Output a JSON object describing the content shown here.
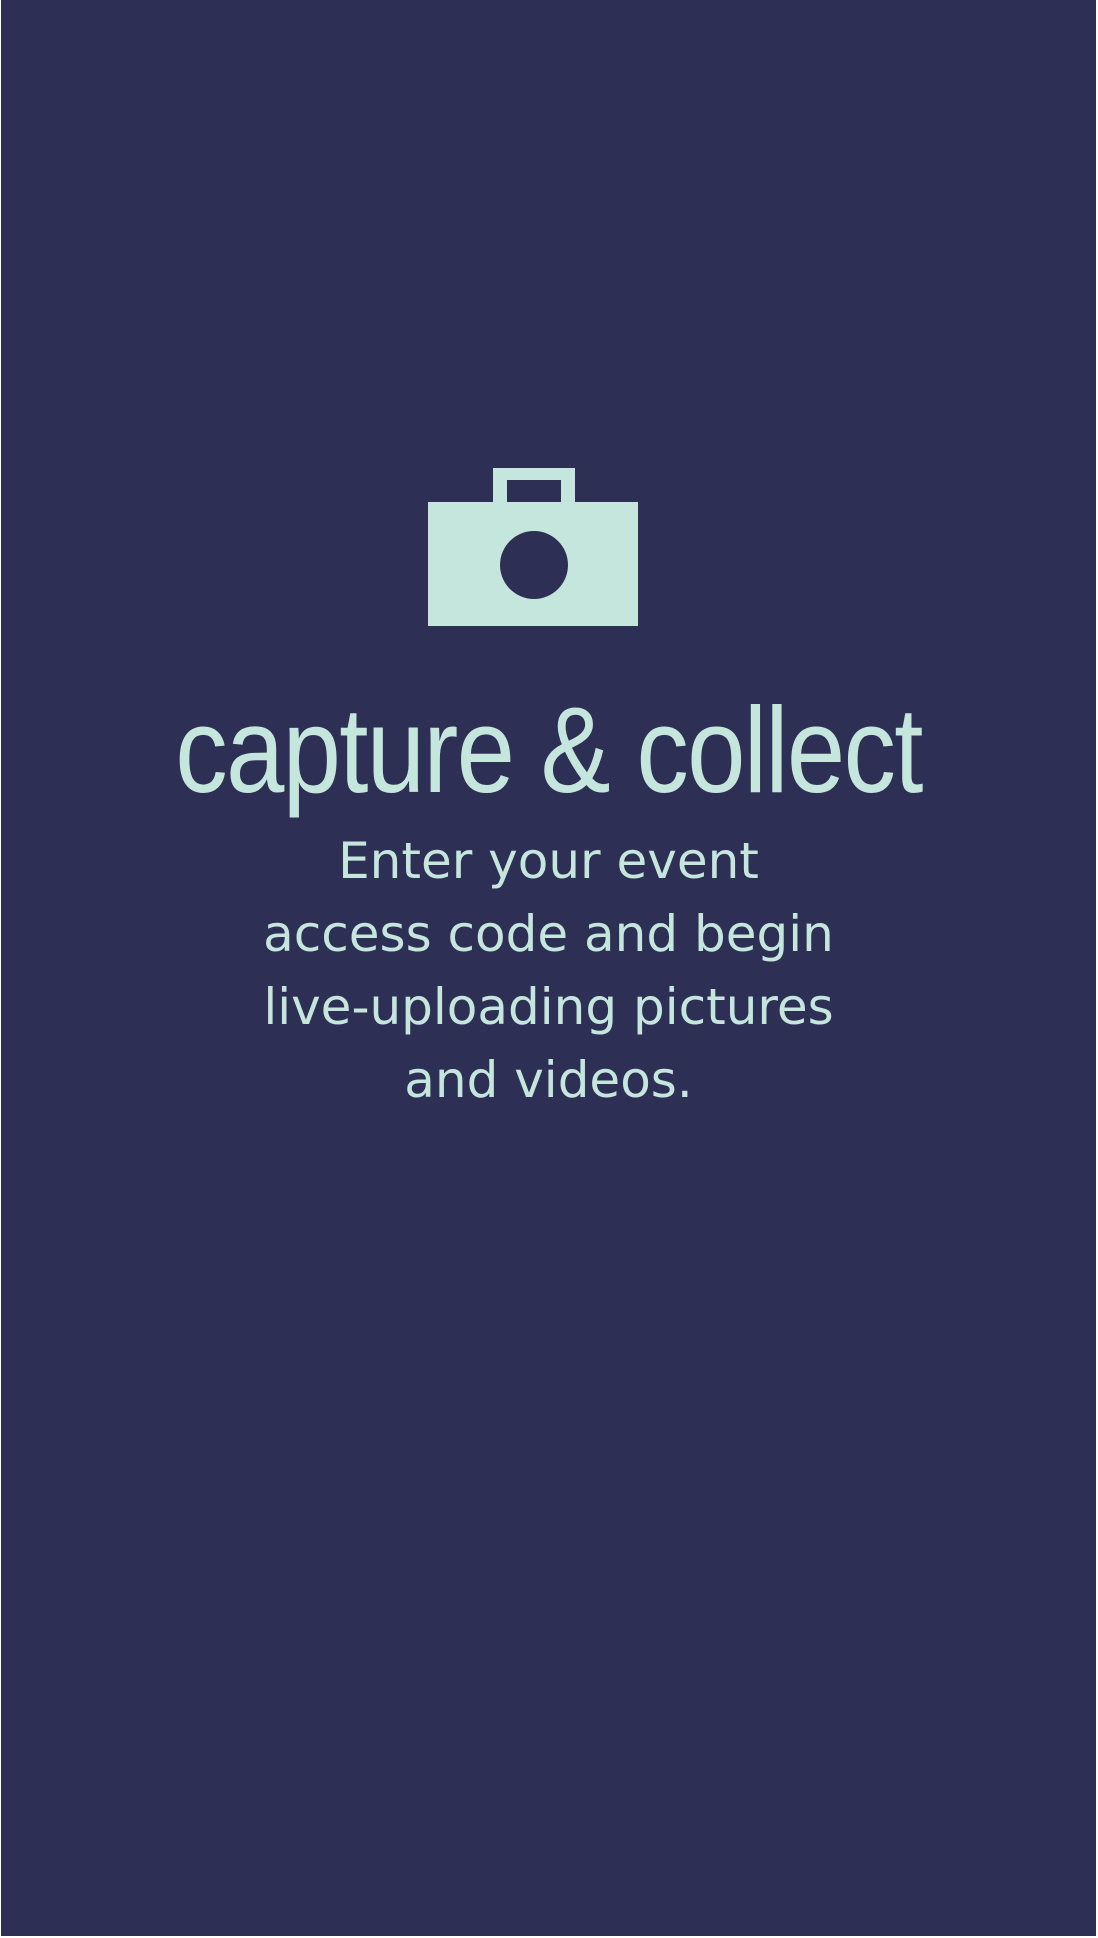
{
  "screen": {
    "background_color": "#2e2f55",
    "accent_color": "#c5e6dc"
  },
  "icon": "camera-icon",
  "headline": "capture & collect",
  "description_lines": [
    "Enter your event",
    "access code and begin",
    "live-uploading pictures",
    "and videos."
  ]
}
